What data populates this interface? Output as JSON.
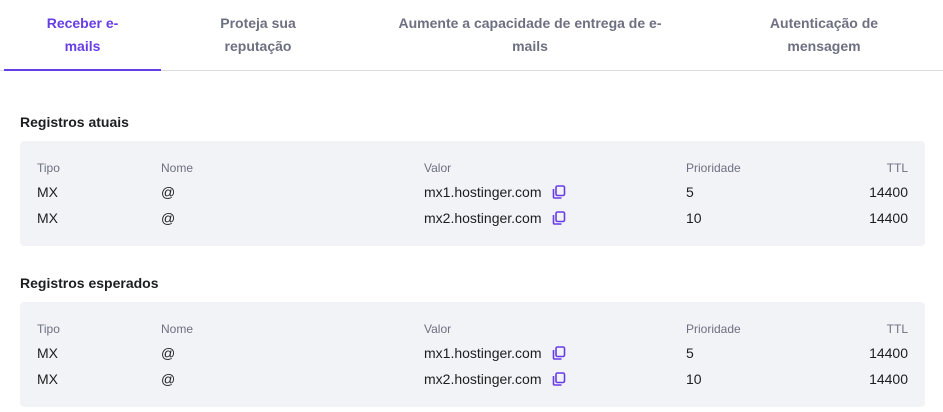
{
  "tabs": [
    {
      "line1": "Receber e-",
      "line2": "mails"
    },
    {
      "line1": "Proteja sua",
      "line2": "reputação"
    },
    {
      "line1": "Aumente a capacidade de entrega de e-",
      "line2": "mails"
    },
    {
      "line1": "Autenticação de",
      "line2": "mensagem"
    }
  ],
  "colors": {
    "accent": "#673de6",
    "card_bg": "#f2f3f6",
    "muted": "#6d7081"
  },
  "headers": {
    "tipo": "Tipo",
    "nome": "Nome",
    "valor": "Valor",
    "prioridade": "Prioridade",
    "ttl": "TTL"
  },
  "current": {
    "title": "Registros atuais",
    "rows": [
      {
        "tipo": "MX",
        "nome": "@",
        "valor": "mx1.hostinger.com",
        "prioridade": "5",
        "ttl": "14400"
      },
      {
        "tipo": "MX",
        "nome": "@",
        "valor": "mx2.hostinger.com",
        "prioridade": "10",
        "ttl": "14400"
      }
    ]
  },
  "expected": {
    "title": "Registros esperados",
    "rows": [
      {
        "tipo": "MX",
        "nome": "@",
        "valor": "mx1.hostinger.com",
        "prioridade": "5",
        "ttl": "14400"
      },
      {
        "tipo": "MX",
        "nome": "@",
        "valor": "mx2.hostinger.com",
        "prioridade": "10",
        "ttl": "14400"
      }
    ]
  },
  "icons": {
    "copy": "copy-icon"
  }
}
